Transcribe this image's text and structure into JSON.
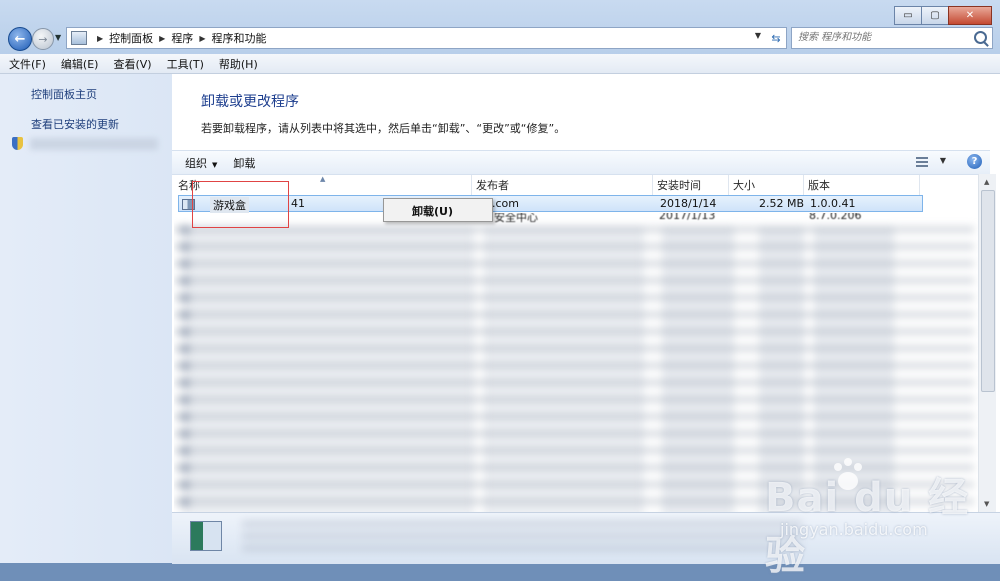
{
  "window": {
    "minimize": "▭",
    "maximize": "▢",
    "close": "✕"
  },
  "address": {
    "crumbs": [
      "控制面板",
      "程序",
      "程序和功能"
    ]
  },
  "search": {
    "placeholder": "搜索 程序和功能"
  },
  "menu": [
    "文件(F)",
    "编辑(E)",
    "查看(V)",
    "工具(T)",
    "帮助(H)"
  ],
  "sidebar": {
    "items": [
      {
        "label": "控制面板主页"
      },
      {
        "label": "查看已安装的更新"
      }
    ]
  },
  "main": {
    "title": "卸载或更改程序",
    "description": "若要卸载程序，请从列表中将其选中，然后单击“卸载”、“更改”或“修复”。"
  },
  "toolbar": {
    "organize_label": "组织",
    "uninstall_label": "卸载"
  },
  "table": {
    "columns": [
      "名称",
      "发布者",
      "安装时间",
      "大小",
      "版本"
    ],
    "selected_row": {
      "name": "游戏盒",
      "name_suffix": "41",
      "publisher": ".com",
      "date": "2018/1/14",
      "size": "2.52 MB",
      "version": "1.0.0.41"
    },
    "second_row": {
      "publisher": "安全中心",
      "date": "2017/1/13",
      "version": "8.7.0.206"
    }
  },
  "context_menu": {
    "uninstall_label": "卸载(U)"
  },
  "watermark": {
    "logo": "Bai du 经验",
    "url": "jingyan.baidu.com"
  },
  "colors": {
    "link": "#1e3e7b",
    "title": "#1e3f8f",
    "selection": "#cfe3fa",
    "highlight_box": "#e04444"
  }
}
